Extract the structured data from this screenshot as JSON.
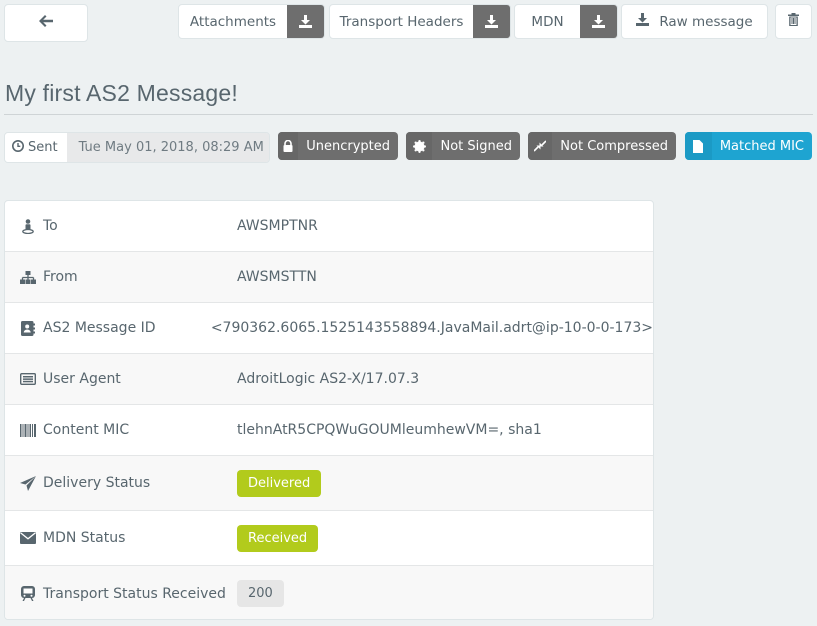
{
  "toolbar": {
    "back_icon": "arrow-left-icon",
    "attachments_label": "Attachments",
    "transport_headers_label": "Transport Headers",
    "mdn_label": "MDN",
    "raw_message_label": "Raw message",
    "download_icon": "download-icon",
    "delete_icon": "trash-icon"
  },
  "title": "My first AS2 Message!",
  "sent": {
    "label": "Sent",
    "icon": "clock-icon",
    "value": "Tue May 01, 2018, 08:29 AM"
  },
  "status_pills": [
    {
      "icon": "lock-icon",
      "label": "Unencrypted",
      "color": "#6e6e6e"
    },
    {
      "icon": "certificate-icon",
      "label": "Not Signed",
      "color": "#6e6e6e"
    },
    {
      "icon": "compress-icon",
      "label": "Not Compressed",
      "color": "#6e6e6e"
    },
    {
      "icon": "file-icon",
      "label": "Matched MIC",
      "color": "#1ea4d1"
    }
  ],
  "details": [
    {
      "icon": "user-icon",
      "label": "To",
      "value": "AWSMPTNR"
    },
    {
      "icon": "sitemap-icon",
      "label": "From",
      "value": "AWSMSTTN"
    },
    {
      "icon": "address-book-icon",
      "label": "AS2 Message ID",
      "value": "<790362.6065.1525143558894.JavaMail.adrt@ip-10-0-0-173>"
    },
    {
      "icon": "list-alt-icon",
      "label": "User Agent",
      "value": "AdroitLogic AS2-X/17.07.3"
    },
    {
      "icon": "barcode-icon",
      "label": "Content MIC",
      "value": "tlehnAtR5CPQWuGOUMleumhewVM=, sha1"
    },
    {
      "icon": "paper-plane-icon",
      "label": "Delivery Status",
      "value": "Delivered",
      "badge_color": "#b2cb1c"
    },
    {
      "icon": "envelope-icon",
      "label": "MDN Status",
      "value": "Received",
      "badge_color": "#b2cb1c"
    },
    {
      "icon": "train-icon",
      "label": "Transport Status Received",
      "value": "200",
      "badge_color": "#e6e6e6"
    }
  ]
}
